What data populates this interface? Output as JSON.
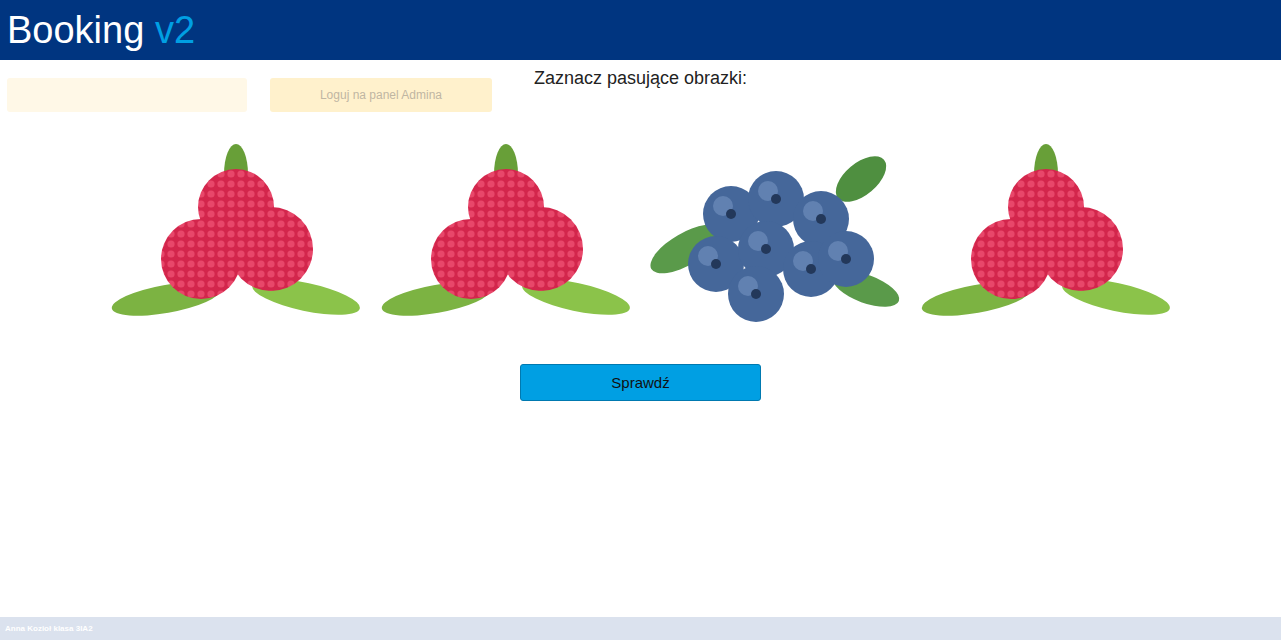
{
  "header": {
    "logo": "Booking",
    "logo_suffix": "v2"
  },
  "login": {
    "input": {
      "value": ""
    },
    "button": "Loguj na panel Admina"
  },
  "captcha": {
    "title": "Zaznacz pasujące obrazki:",
    "images": [
      {
        "kind": "raspberry",
        "selected": false
      },
      {
        "kind": "raspberry",
        "selected": false
      },
      {
        "kind": "blueberry",
        "selected": false
      },
      {
        "kind": "raspberry",
        "selected": false
      }
    ],
    "button": "Sprawdź"
  },
  "footer": "Anna Kozioł klasa 3IA2"
}
